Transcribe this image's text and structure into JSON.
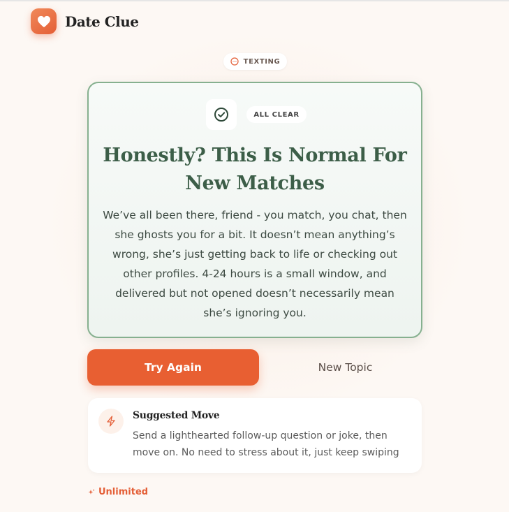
{
  "app": {
    "name": "Date Clue"
  },
  "category_chip": {
    "label": "TEXTING",
    "icon": "chat-bubble-icon"
  },
  "result_card": {
    "status_label": "ALL CLEAR",
    "status_icon": "check-circle-icon",
    "title": "Honestly? This Is Normal For New Matches",
    "body": "We’ve all been there, friend - you match, you chat, then she ghosts you for a bit. It doesn’t mean anything’s wrong, she’s just getting back to life or checking out other profiles. 4-24 hours is a small window, and delivered but not opened doesn’t necessarily mean she’s ignoring you."
  },
  "actions": {
    "try_again_label": "Try Again",
    "new_topic_label": "New Topic"
  },
  "suggestion": {
    "icon": "lightning-bolt-icon",
    "title": "Suggested Move",
    "body": "Send a lighthearted follow-up question or joke, then move on. No need to stress about it, just keep swiping"
  },
  "plan": {
    "label": "Unlimited",
    "icon": "sparkle-icon"
  },
  "colors": {
    "accent": "#e85f32",
    "success_border": "#86b08f",
    "success_text": "#3c5e48",
    "background": "#fdf8f4"
  }
}
